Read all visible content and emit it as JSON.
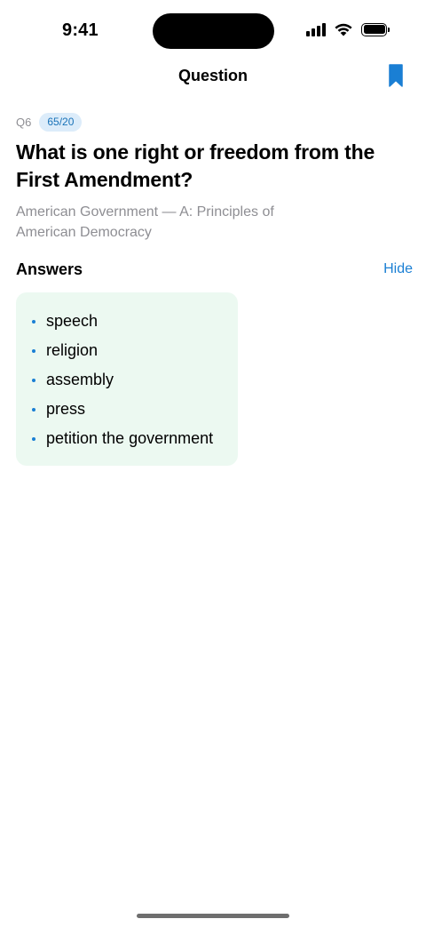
{
  "status_bar": {
    "time": "9:41",
    "icons": [
      "signal-icon",
      "wifi-icon",
      "battery-icon"
    ]
  },
  "nav": {
    "title": "Question",
    "bookmark_icon": "bookmark-icon",
    "accent_color": "#1a7fd4"
  },
  "question": {
    "number": "Q6",
    "progress": "65/20",
    "text": "What is one right or freedom from the First Amendment?",
    "category": "American Government — A: Principles of American Democracy"
  },
  "answers": {
    "title": "Answers",
    "hide_label": "Hide",
    "card_color": "#ecf9f1",
    "items": [
      "speech",
      "religion",
      "assembly",
      "press",
      "petition the government"
    ]
  }
}
